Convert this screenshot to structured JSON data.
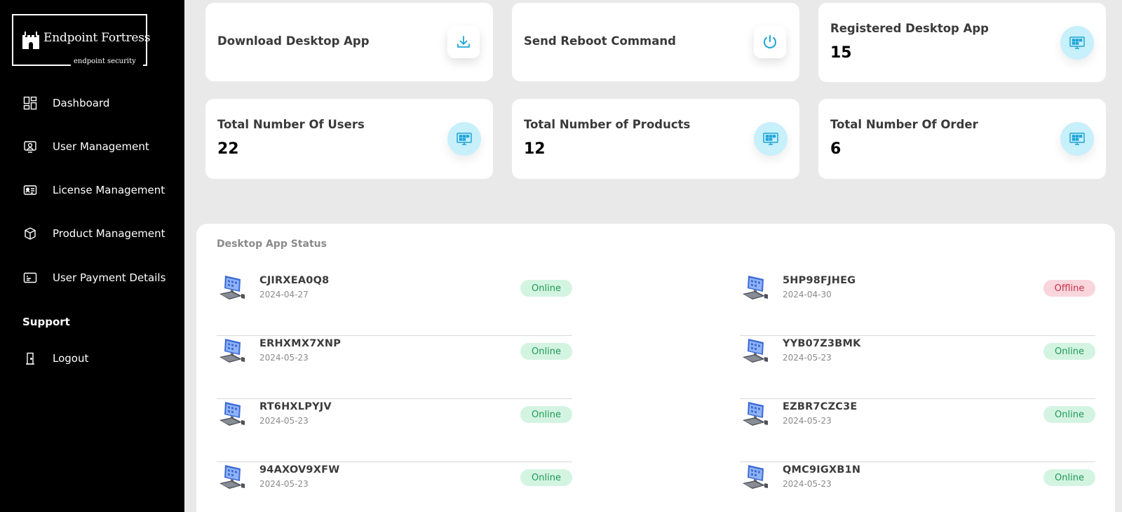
{
  "brand": {
    "name": "Endpoint Fortress",
    "tagline": "endpoint security"
  },
  "sidebar": {
    "items": [
      {
        "label": "Dashboard",
        "icon": "dashboard-grid-icon"
      },
      {
        "label": "User Management",
        "icon": "user-card-icon"
      },
      {
        "label": "License Management",
        "icon": "id-card-icon"
      },
      {
        "label": "Product Management",
        "icon": "box-icon"
      },
      {
        "label": "User Payment Details",
        "icon": "payment-card-icon"
      }
    ],
    "support_title": "Support",
    "logout_label": "Logout"
  },
  "cards": [
    {
      "title": "Download Desktop App",
      "value": "",
      "icon": "download-icon"
    },
    {
      "title": "Send Reboot Command",
      "value": "",
      "icon": "power-icon"
    },
    {
      "title": "Registered Desktop App",
      "value": "15",
      "icon": "monitor-icon"
    },
    {
      "title": "Total Number Of Users",
      "value": "22",
      "icon": "monitor-icon"
    },
    {
      "title": "Total Number of Products",
      "value": "12",
      "icon": "monitor-icon"
    },
    {
      "title": "Total Number Of Order",
      "value": "6",
      "icon": "monitor-icon"
    }
  ],
  "status_panel": {
    "title": "Desktop App Status",
    "devices": [
      {
        "id": "CJIRXEA0Q8",
        "date": "2024-04-27",
        "status": "Online"
      },
      {
        "id": "5HP98FJHEG",
        "date": "2024-04-30",
        "status": "Offline"
      },
      {
        "id": "ERHXMX7XNP",
        "date": "2024-05-23",
        "status": "Online"
      },
      {
        "id": "YYB07Z3BMK",
        "date": "2024-05-23",
        "status": "Online"
      },
      {
        "id": "RT6HXLPYJV",
        "date": "2024-05-23",
        "status": "Online"
      },
      {
        "id": "EZBR7CZC3E",
        "date": "2024-05-23",
        "status": "Online"
      },
      {
        "id": "94AXOV9XFW",
        "date": "2024-05-23",
        "status": "Online"
      },
      {
        "id": "QMC9IGXB1N",
        "date": "2024-05-23",
        "status": "Online"
      }
    ]
  },
  "colors": {
    "sidebar_bg": "#000000",
    "page_bg": "#e9e9e9",
    "accent": "#1ea4d8",
    "icon_circle": "#c7f0fb",
    "online_bg": "#d4f4e2",
    "online_text": "#1e9a55",
    "offline_bg": "#f8d6dc",
    "offline_text": "#c8324a"
  }
}
